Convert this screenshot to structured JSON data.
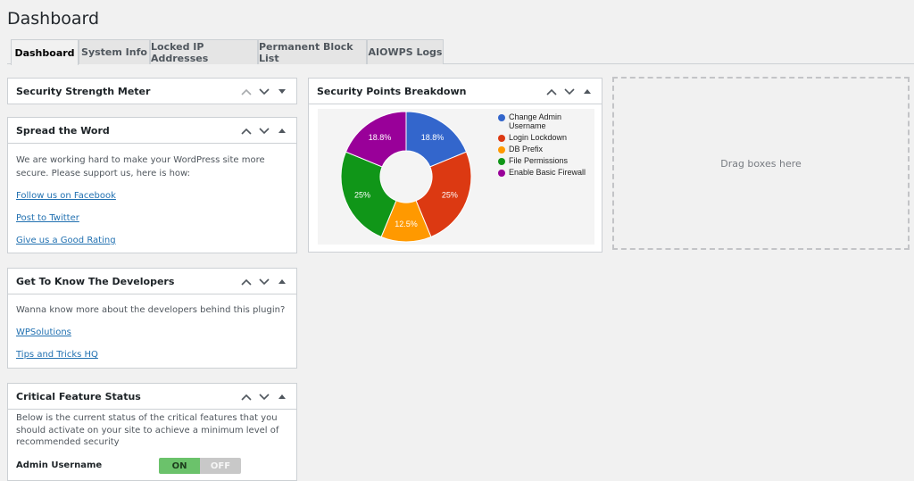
{
  "page": {
    "title": "Dashboard"
  },
  "tabs": [
    {
      "label": "Dashboard",
      "active": true
    },
    {
      "label": "System Info",
      "active": false
    },
    {
      "label": "Locked IP Addresses",
      "active": false
    },
    {
      "label": "Permanent Block List",
      "active": false
    },
    {
      "label": "AIOWPS Logs",
      "active": false
    }
  ],
  "widgets": {
    "strength_meter": {
      "title": "Security Strength Meter",
      "state": "collapsed"
    },
    "spread_word": {
      "title": "Spread the Word",
      "text": "We are working hard to make your WordPress site more secure. Please support us, here is how:",
      "links": [
        "Follow us on Facebook",
        "Post to Twitter",
        "Give us a Good Rating"
      ]
    },
    "developers": {
      "title": "Get To Know The Developers",
      "text": "Wanna know more about the developers behind this plugin?",
      "links": [
        "WPSolutions",
        "Tips and Tricks HQ"
      ]
    },
    "critical": {
      "title": "Critical Feature Status",
      "text": "Below is the current status of the critical features that you should activate on your site to achieve a minimum level of recommended security",
      "features": [
        {
          "label": "Admin Username",
          "on_label": "ON",
          "off_label": "OFF",
          "state": "on"
        }
      ]
    },
    "points": {
      "title": "Security Points Breakdown"
    }
  },
  "drop_zone": {
    "text": "Drag boxes here"
  },
  "chart_data": {
    "type": "pie",
    "donut": true,
    "title": "Security Points Breakdown",
    "legend_position": "right",
    "categories": [
      "Change Admin Username",
      "Login Lockdown",
      "DB Prefix",
      "File Permissions",
      "Enable Basic Firewall"
    ],
    "values": [
      18.8,
      25,
      12.5,
      25,
      18.8
    ],
    "labels": [
      "18.8%",
      "25%",
      "12.5%",
      "25%",
      "18.8%"
    ],
    "colors": [
      "#3366cc",
      "#dc3912",
      "#ff9900",
      "#109618",
      "#990099"
    ]
  }
}
